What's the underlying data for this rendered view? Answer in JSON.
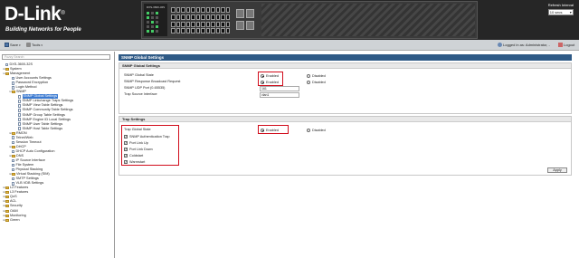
{
  "header": {
    "brand": "D-Link",
    "tagline": "Building Networks for People",
    "device_model": "DXS-3600-32S",
    "refresh_label": "Refresh Interval",
    "refresh_value": "10 secs"
  },
  "menubar": {
    "save": "Save",
    "tools": "Tools",
    "logged_in": "Logged in as: Administrator, -",
    "logout": "Logout"
  },
  "sidebar": {
    "search_placeholder": "Fuzzy Search",
    "items": [
      {
        "label": "DXS-3600-32S",
        "level": 0,
        "kind": "page"
      },
      {
        "label": "System",
        "level": 0,
        "kind": "folder",
        "toggle": "+"
      },
      {
        "label": "Management",
        "level": 0,
        "kind": "folder",
        "toggle": "-"
      },
      {
        "label": "User Accounts Settings",
        "level": 1,
        "kind": "page"
      },
      {
        "label": "Password Encryption",
        "level": 1,
        "kind": "page"
      },
      {
        "label": "Login Method",
        "level": 1,
        "kind": "page"
      },
      {
        "label": "SNMP",
        "level": 1,
        "kind": "folder",
        "toggle": "-"
      },
      {
        "label": "SNMP Global Settings",
        "level": 2,
        "kind": "page",
        "selected": true
      },
      {
        "label": "SNMP Linkchange Traps Settings",
        "level": 2,
        "kind": "page"
      },
      {
        "label": "SNMP View Table Settings",
        "level": 2,
        "kind": "page"
      },
      {
        "label": "SNMP Community Table Settings",
        "level": 2,
        "kind": "page"
      },
      {
        "label": "SNMP Group Table Settings",
        "level": 2,
        "kind": "page"
      },
      {
        "label": "SNMP Engine ID Local Settings",
        "level": 2,
        "kind": "page"
      },
      {
        "label": "SNMP User Table Settings",
        "level": 2,
        "kind": "page"
      },
      {
        "label": "SNMP Host Table Settings",
        "level": 2,
        "kind": "page"
      },
      {
        "label": "RMON",
        "level": 1,
        "kind": "folder",
        "toggle": "+"
      },
      {
        "label": "Telnet/Web",
        "level": 1,
        "kind": "page"
      },
      {
        "label": "Session Timeout",
        "level": 1,
        "kind": "page"
      },
      {
        "label": "DHCP",
        "level": 1,
        "kind": "folder",
        "toggle": "+"
      },
      {
        "label": "DHCP Auto Configuration",
        "level": 1,
        "kind": "page"
      },
      {
        "label": "DNS",
        "level": 1,
        "kind": "folder",
        "toggle": "+"
      },
      {
        "label": "IP Source Interface",
        "level": 1,
        "kind": "page"
      },
      {
        "label": "File System",
        "level": 1,
        "kind": "page"
      },
      {
        "label": "Physical Stacking",
        "level": 1,
        "kind": "page"
      },
      {
        "label": "Virtual Stacking (SIM)",
        "level": 1,
        "kind": "folder",
        "toggle": "+"
      },
      {
        "label": "SMTP Settings",
        "level": 1,
        "kind": "page"
      },
      {
        "label": "VLB VDB Settings",
        "level": 1,
        "kind": "page"
      },
      {
        "label": "L2 Features",
        "level": 0,
        "kind": "folder",
        "toggle": "+"
      },
      {
        "label": "L3 Features",
        "level": 0,
        "kind": "folder",
        "toggle": "+"
      },
      {
        "label": "QoS",
        "level": 0,
        "kind": "folder",
        "toggle": "+"
      },
      {
        "label": "ACL",
        "level": 0,
        "kind": "folder",
        "toggle": "+"
      },
      {
        "label": "Security",
        "level": 0,
        "kind": "folder",
        "toggle": "+"
      },
      {
        "label": "OAM",
        "level": 0,
        "kind": "folder",
        "toggle": "+"
      },
      {
        "label": "Monitoring",
        "level": 0,
        "kind": "folder",
        "toggle": "+"
      },
      {
        "label": "Green",
        "level": 0,
        "kind": "folder",
        "toggle": "+"
      }
    ]
  },
  "page": {
    "title": "SNMP Global Settings",
    "global": {
      "heading": "SNMP Global Settings",
      "state_label": "SNMP Global State",
      "response_label": "SNMP Response Broadcast Request",
      "port_label": "SNMP UDP Port (0-65535)",
      "port_value": "161",
      "source_label": "Trap Source Interface",
      "source_value": "vlan1",
      "enabled": "Enabled",
      "disabled": "Disabled"
    },
    "trap": {
      "heading": "Trap Settings",
      "state_label": "Trap Global State",
      "enabled": "Enabled",
      "disabled": "Disabled",
      "options": [
        "SNMP Authentication Trap",
        "Port Link Up",
        "Port Link Down",
        "Coldstart",
        "Warmstart"
      ]
    },
    "apply": "Apply"
  },
  "colors": {
    "highlight": "#d10d1c",
    "title_bar": "#2f5a86",
    "selected": "#3b7ad1"
  }
}
